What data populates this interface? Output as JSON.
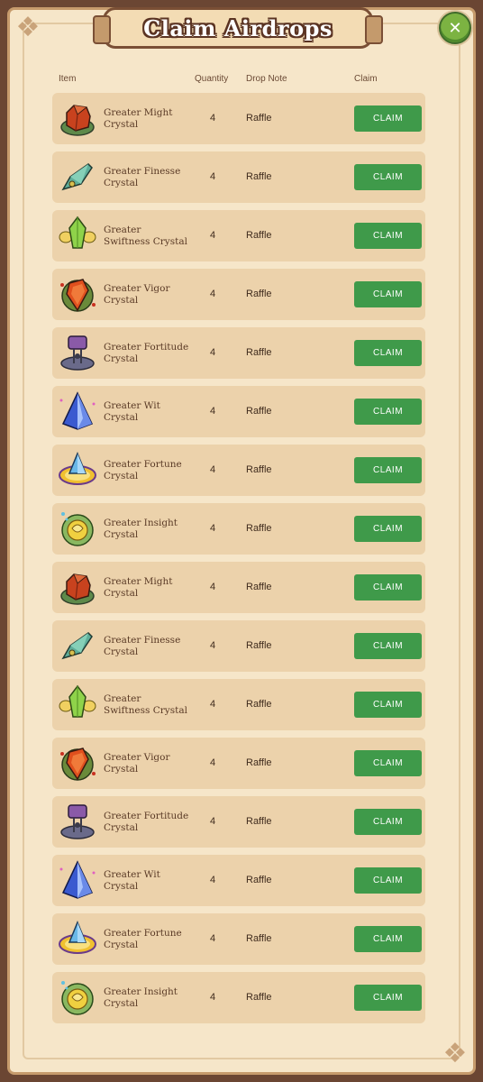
{
  "header": {
    "title": "Claim Airdrops",
    "close_icon": "close-icon"
  },
  "columns": {
    "item": "Item",
    "quantity": "Quantity",
    "drop_note": "Drop Note",
    "claim": "Claim"
  },
  "colors": {
    "claim_button": "#3f9a4a",
    "row_bg": "#ecd2ab",
    "panel_bg": "#f6e6c9",
    "frame": "#6b4633"
  },
  "rows": [
    {
      "name": "Greater Might Crystal",
      "quantity": "4",
      "note": "Raffle",
      "claim": "CLAIM",
      "icon": "might-crystal-icon"
    },
    {
      "name": "Greater Finesse Crystal",
      "quantity": "4",
      "note": "Raffle",
      "claim": "CLAIM",
      "icon": "finesse-crystal-icon"
    },
    {
      "name": "Greater Swiftness Crystal",
      "quantity": "4",
      "note": "Raffle",
      "claim": "CLAIM",
      "icon": "swiftness-crystal-icon"
    },
    {
      "name": "Greater Vigor Crystal",
      "quantity": "4",
      "note": "Raffle",
      "claim": "CLAIM",
      "icon": "vigor-crystal-icon"
    },
    {
      "name": "Greater Fortitude Crystal",
      "quantity": "4",
      "note": "Raffle",
      "claim": "CLAIM",
      "icon": "fortitude-crystal-icon"
    },
    {
      "name": "Greater Wit Crystal",
      "quantity": "4",
      "note": "Raffle",
      "claim": "CLAIM",
      "icon": "wit-crystal-icon"
    },
    {
      "name": "Greater Fortune Crystal",
      "quantity": "4",
      "note": "Raffle",
      "claim": "CLAIM",
      "icon": "fortune-crystal-icon"
    },
    {
      "name": "Greater Insight Crystal",
      "quantity": "4",
      "note": "Raffle",
      "claim": "CLAIM",
      "icon": "insight-crystal-icon"
    },
    {
      "name": "Greater Might Crystal",
      "quantity": "4",
      "note": "Raffle",
      "claim": "CLAIM",
      "icon": "might-crystal-icon"
    },
    {
      "name": "Greater Finesse Crystal",
      "quantity": "4",
      "note": "Raffle",
      "claim": "CLAIM",
      "icon": "finesse-crystal-icon"
    },
    {
      "name": "Greater Swiftness Crystal",
      "quantity": "4",
      "note": "Raffle",
      "claim": "CLAIM",
      "icon": "swiftness-crystal-icon"
    },
    {
      "name": "Greater Vigor Crystal",
      "quantity": "4",
      "note": "Raffle",
      "claim": "CLAIM",
      "icon": "vigor-crystal-icon"
    },
    {
      "name": "Greater Fortitude Crystal",
      "quantity": "4",
      "note": "Raffle",
      "claim": "CLAIM",
      "icon": "fortitude-crystal-icon"
    },
    {
      "name": "Greater Wit Crystal",
      "quantity": "4",
      "note": "Raffle",
      "claim": "CLAIM",
      "icon": "wit-crystal-icon"
    },
    {
      "name": "Greater Fortune Crystal",
      "quantity": "4",
      "note": "Raffle",
      "claim": "CLAIM",
      "icon": "fortune-crystal-icon"
    },
    {
      "name": "Greater Insight Crystal",
      "quantity": "4",
      "note": "Raffle",
      "claim": "CLAIM",
      "icon": "insight-crystal-icon"
    }
  ]
}
